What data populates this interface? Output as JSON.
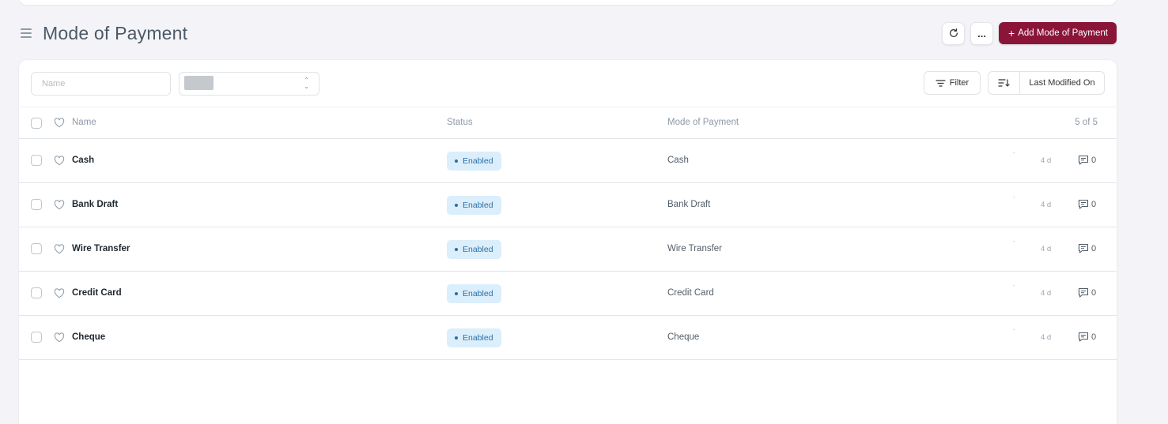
{
  "page": {
    "title": "Mode of Payment",
    "add_button_label": "Add Mode of Payment",
    "more_label": "..."
  },
  "filters": {
    "name_placeholder": "Name",
    "filter_label": "Filter",
    "sort_label": "Last Modified On"
  },
  "list": {
    "headers": {
      "name": "Name",
      "status": "Status",
      "mode_of_payment": "Mode of Payment",
      "count": "5 of 5"
    },
    "rows": [
      {
        "name": "Cash",
        "status": "Enabled",
        "mode_of_payment": "Cash",
        "modified": "4 d",
        "comments": "0"
      },
      {
        "name": "Bank Draft",
        "status": "Enabled",
        "mode_of_payment": "Bank Draft",
        "modified": "4 d",
        "comments": "0"
      },
      {
        "name": "Wire Transfer",
        "status": "Enabled",
        "mode_of_payment": "Wire Transfer",
        "modified": "4 d",
        "comments": "0"
      },
      {
        "name": "Credit Card",
        "status": "Enabled",
        "mode_of_payment": "Credit Card",
        "modified": "4 d",
        "comments": "0"
      },
      {
        "name": "Cheque",
        "status": "Enabled",
        "mode_of_payment": "Cheque",
        "modified": "4 d",
        "comments": "0"
      }
    ]
  },
  "colors": {
    "primary": "#8a1538",
    "badge_bg": "#dbeefb",
    "badge_text": "#2c6fa8",
    "page_bg": "#f4f4f8"
  },
  "icons": {
    "menu": "hamburger-icon",
    "refresh": "refresh-icon",
    "more": "more-icon",
    "add": "plus-icon",
    "filter": "filter-icon",
    "sort": "sort-icon",
    "like": "heart-icon",
    "comment": "comment-icon"
  }
}
